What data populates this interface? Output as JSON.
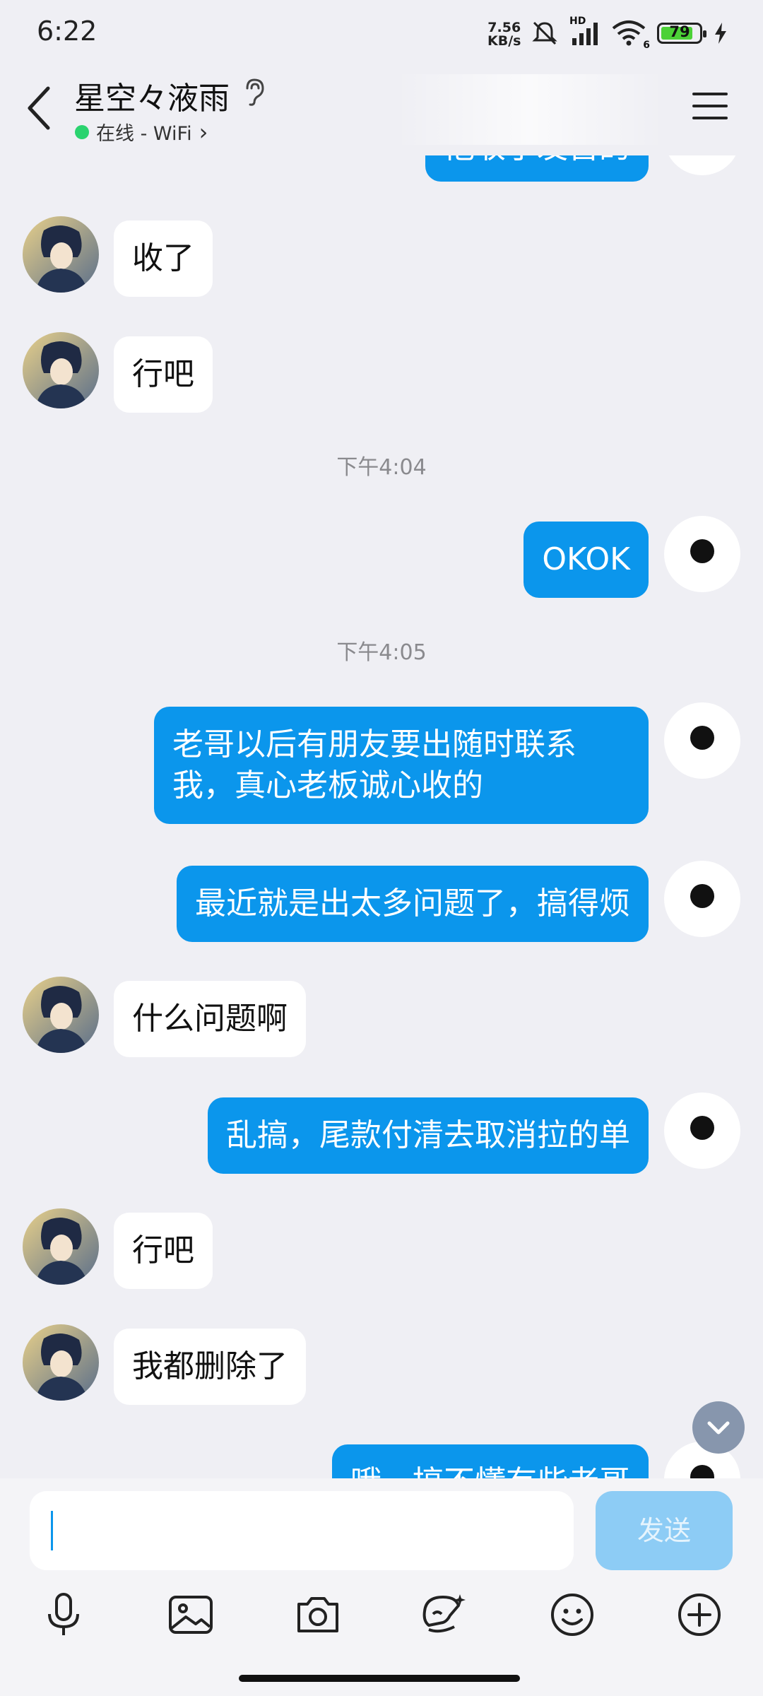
{
  "status_bar": {
    "time": "6:22",
    "net_speed_value": "7.56",
    "net_speed_unit": "KB/s",
    "hd_label": "HD",
    "wifi_label": "6",
    "battery": "79"
  },
  "header": {
    "contact_name": "星空々液雨",
    "status_text": "在线 - WiFi",
    "status_chevron": "›"
  },
  "messages": [
    {
      "side": "out",
      "text": "他收了发售的"
    },
    {
      "side": "in",
      "text": "收了"
    },
    {
      "side": "in",
      "text": "行吧"
    },
    {
      "type": "time",
      "text": "下午4:04"
    },
    {
      "side": "out",
      "text": "OKOK"
    },
    {
      "type": "time",
      "text": "下午4:05"
    },
    {
      "side": "out",
      "text": "老哥以后有朋友要出随时联系我，真心老板诚心收的"
    },
    {
      "side": "out",
      "text": "最近就是出太多问题了，搞得烦"
    },
    {
      "side": "in",
      "text": "什么问题啊"
    },
    {
      "side": "out",
      "text": "乱搞，尾款付清去取消拉的单"
    },
    {
      "side": "in",
      "text": "行吧"
    },
    {
      "side": "in",
      "text": "我都删除了"
    },
    {
      "side": "out",
      "text": "哦，搞不懂有些老哥"
    }
  ],
  "input": {
    "value": "",
    "send_label": "发送"
  },
  "toolbar": [
    "mic-icon",
    "image-icon",
    "camera-icon",
    "sticker-icon",
    "emoji-icon",
    "plus-icon"
  ],
  "colors": {
    "background": "#efeff4",
    "out_bubble": "#0b96ec",
    "in_bubble": "#ffffff",
    "online_dot": "#2ad36f",
    "send_button": "#8dccf5"
  }
}
